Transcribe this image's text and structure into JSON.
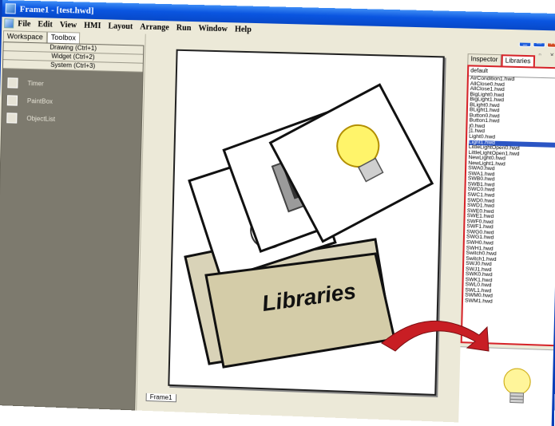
{
  "window": {
    "title": "Frame1 - [test.hwd]",
    "sys_buttons": [
      "_",
      "□",
      "X"
    ],
    "mdi_buttons": "_ ▫ ×"
  },
  "menu": [
    "File",
    "Edit",
    "View",
    "HMI",
    "Layout",
    "Arrange",
    "Run",
    "Window",
    "Help"
  ],
  "left_panel": {
    "tabs": [
      "Workspace",
      "Toolbox"
    ],
    "categories": [
      "Drawing (Ctrl+1)",
      "Widget (Ctrl+2)",
      "System (Ctrl+3)"
    ],
    "tools": [
      {
        "label": "Timer",
        "icon": "clock-icon"
      },
      {
        "label": "PaintBox",
        "icon": "paintbox-icon"
      },
      {
        "label": "ObjectList",
        "icon": "objectlist-icon"
      }
    ]
  },
  "workspace": {
    "frame_tab": "Frame1",
    "overlay_label": "Libraries"
  },
  "right_panel": {
    "tabs": [
      "Inspector",
      "Libraries"
    ],
    "selected_library": "default",
    "files": [
      "AirCondition1.hwd",
      "AllClose0.hwd",
      "AllClose1.hwd",
      "BigLight0.hwd",
      "BigLight1.hwd",
      "BLight0.hwd",
      "BLight1.hwd",
      "Button0.hwd",
      "Button1.hwd",
      "j0.hwd",
      "j1.hwd",
      "Light0.hwd",
      "Light1.hwd",
      "LittleLightOpen0.hwd",
      "LittleLightOpen1.hwd",
      "NewLight0.hwd",
      "NewLight1.hwd",
      "SWA0.hwd",
      "SWA1.hwd",
      "SWB0.hwd",
      "SWB1.hwd",
      "SWC0.hwd",
      "SWC1.hwd",
      "SWD0.hwd",
      "SWD1.hwd",
      "SWE0.hwd",
      "SWE1.hwd",
      "SWF0.hwd",
      "SWF1.hwd",
      "SWG0.hwd",
      "SWG1.hwd",
      "SWH0.hwd",
      "SWH1.hwd",
      "Switch0.hwd",
      "Switch1.hwd",
      "SWJ0.hwd",
      "SWJ1.hwd",
      "SWK0.hwd",
      "SWK1.hwd",
      "SWL0.hwd",
      "SWL1.hwd",
      "SWM0.hwd",
      "SWM1.hwd"
    ],
    "selected_file": "Light1.hwd"
  },
  "colors": {
    "titlebar": "#0a55e0",
    "highlight_red": "#d6242a",
    "selection_blue": "#2b55c4"
  }
}
